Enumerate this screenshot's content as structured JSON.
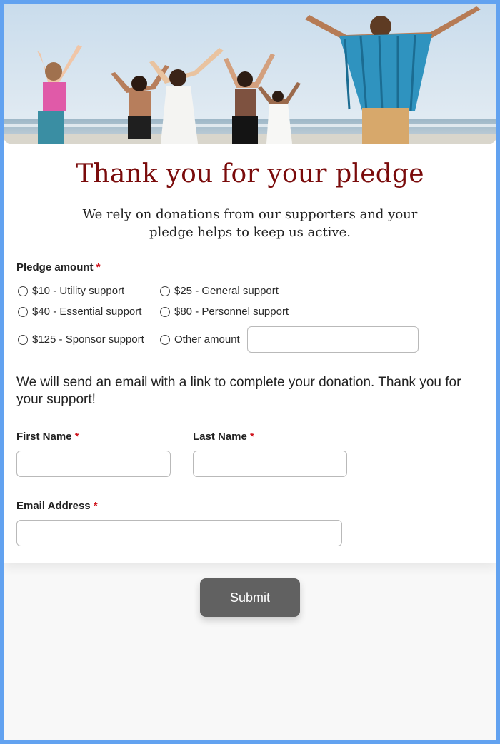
{
  "header": {
    "title": "Thank you for your pledge",
    "subtitle": "We rely on donations from our supporters and your pledge helps to keep us active."
  },
  "pledge": {
    "label": "Pledge amount",
    "required_mark": "*",
    "options": [
      {
        "label": "$10 - Utility support",
        "selected": false
      },
      {
        "label": "$25 - General support",
        "selected": false
      },
      {
        "label": "$40 - Essential support",
        "selected": false
      },
      {
        "label": "$80 - Personnel support",
        "selected": false
      },
      {
        "label": "$125 - Sponsor support",
        "selected": false
      },
      {
        "label": "Other amount",
        "selected": false
      }
    ],
    "other_amount_value": ""
  },
  "notice": "We will send an email with a link to complete your donation. Thank you for your support!",
  "fields": {
    "first_name": {
      "label": "First Name",
      "required_mark": "*",
      "value": ""
    },
    "last_name": {
      "label": "Last Name",
      "required_mark": "*",
      "value": ""
    },
    "email": {
      "label": "Email Address",
      "required_mark": "*",
      "value": ""
    }
  },
  "submit_label": "Submit",
  "colors": {
    "page_border": "#62a2f0",
    "title": "#7a0b0b",
    "required": "#d0161f",
    "submit_bg": "#616161"
  }
}
